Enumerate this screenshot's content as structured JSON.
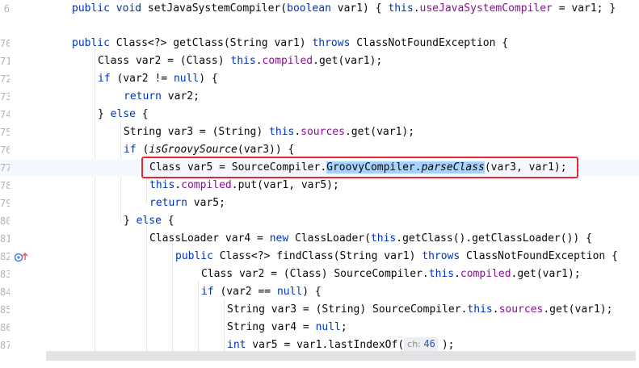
{
  "editor": {
    "line_numbers": [
      "6",
      "70",
      "71",
      "72",
      "73",
      "74",
      "75",
      "76",
      "77",
      "78",
      "79",
      "80",
      "81",
      "82",
      "83",
      "84",
      "85",
      "86",
      "87"
    ],
    "lines": [
      [
        {
          "t": "public void ",
          "c": "kw"
        },
        {
          "t": "setJavaSystemCompiler",
          "c": ""
        },
        {
          "t": "(",
          "c": ""
        },
        {
          "t": "boolean",
          "c": "kw"
        },
        {
          "t": " var1) { ",
          "c": ""
        },
        {
          "t": "this",
          "c": "kw"
        },
        {
          "t": ".",
          "c": ""
        },
        {
          "t": "useJavaSystemCompiler",
          "c": "fld"
        },
        {
          "t": " = var1; }",
          "c": ""
        }
      ],
      [
        {
          "t": "public ",
          "c": "kw"
        },
        {
          "t": "Class<?> getClass(String var1) ",
          "c": ""
        },
        {
          "t": "throws",
          "c": "kw"
        },
        {
          "t": " ClassNotFoundException {",
          "c": ""
        }
      ],
      [
        {
          "t": "Class var2 = (Class) ",
          "c": ""
        },
        {
          "t": "this",
          "c": "kw"
        },
        {
          "t": ".",
          "c": ""
        },
        {
          "t": "compiled",
          "c": "fld"
        },
        {
          "t": ".get(var1);",
          "c": ""
        }
      ],
      [
        {
          "t": "if",
          "c": "kw"
        },
        {
          "t": " (var2 != ",
          "c": ""
        },
        {
          "t": "null",
          "c": "kw"
        },
        {
          "t": ") {",
          "c": ""
        }
      ],
      [
        {
          "t": "return",
          "c": "kw"
        },
        {
          "t": " var2;",
          "c": ""
        }
      ],
      [
        {
          "t": "} ",
          "c": ""
        },
        {
          "t": "else",
          "c": "kw"
        },
        {
          "t": " {",
          "c": ""
        }
      ],
      [
        {
          "t": "String var3 = (String) ",
          "c": ""
        },
        {
          "t": "this",
          "c": "kw"
        },
        {
          "t": ".",
          "c": ""
        },
        {
          "t": "sources",
          "c": "fld"
        },
        {
          "t": ".get(var1);",
          "c": ""
        }
      ],
      [
        {
          "t": "if",
          "c": "kw"
        },
        {
          "t": " (",
          "c": ""
        },
        {
          "t": "isGroovySource",
          "c": "it"
        },
        {
          "t": "(var3)) {",
          "c": ""
        }
      ],
      [
        {
          "t": "Class var5 = SourceCompiler.",
          "c": ""
        },
        {
          "t": "GroovyCompiler.",
          "c": "sel"
        },
        {
          "t": "parseClass",
          "c": "it sel"
        },
        {
          "t": "(var3, var1);",
          "c": ""
        }
      ],
      [
        {
          "t": "this",
          "c": "kw"
        },
        {
          "t": ".",
          "c": ""
        },
        {
          "t": "compiled",
          "c": "fld"
        },
        {
          "t": ".put(var1, var5);",
          "c": ""
        }
      ],
      [
        {
          "t": "return",
          "c": "kw"
        },
        {
          "t": " var5;",
          "c": ""
        }
      ],
      [
        {
          "t": "} ",
          "c": ""
        },
        {
          "t": "else",
          "c": "kw"
        },
        {
          "t": " {",
          "c": ""
        }
      ],
      [
        {
          "t": "ClassLoader var4 = ",
          "c": ""
        },
        {
          "t": "new",
          "c": "kw"
        },
        {
          "t": " ClassLoader(",
          "c": ""
        },
        {
          "t": "this",
          "c": "kw"
        },
        {
          "t": ".getClass().getClassLoader()) {",
          "c": ""
        }
      ],
      [
        {
          "t": "public ",
          "c": "kw"
        },
        {
          "t": "Class<?> findClass(String var1) ",
          "c": ""
        },
        {
          "t": "throws",
          "c": "kw"
        },
        {
          "t": " ClassNotFoundException {",
          "c": ""
        }
      ],
      [
        {
          "t": "Class var2 = (Class) SourceCompiler.",
          "c": ""
        },
        {
          "t": "this",
          "c": "kw"
        },
        {
          "t": ".",
          "c": ""
        },
        {
          "t": "compiled",
          "c": "fld"
        },
        {
          "t": ".get(var1);",
          "c": ""
        }
      ],
      [
        {
          "t": "if",
          "c": "kw"
        },
        {
          "t": " (var2 == ",
          "c": ""
        },
        {
          "t": "null",
          "c": "kw"
        },
        {
          "t": ") {",
          "c": ""
        }
      ],
      [
        {
          "t": "String var3 = (String) SourceCompiler.",
          "c": ""
        },
        {
          "t": "this",
          "c": "kw"
        },
        {
          "t": ".",
          "c": ""
        },
        {
          "t": "sources",
          "c": "fld"
        },
        {
          "t": ".get(var1);",
          "c": ""
        }
      ],
      [
        {
          "t": "String var4 = ",
          "c": ""
        },
        {
          "t": "null",
          "c": "kw"
        },
        {
          "t": ";",
          "c": ""
        }
      ],
      [
        {
          "t": "int",
          "c": "kw"
        },
        {
          "t": " var5 = var1.lastIndexOf(",
          "c": ""
        },
        {
          "t": "HINT",
          "c": "hint"
        },
        {
          "t": ");",
          "c": ""
        }
      ]
    ],
    "inlay_hint": {
      "name": "ch:",
      "value": "46"
    },
    "current_line_number": "77",
    "gutter_icons": [
      "override-icon",
      "up-arrow-icon"
    ],
    "colors": {
      "keyword": "#0033b3",
      "field": "#871094",
      "selection": "#a6d2ff",
      "annotation_box": "#e8262c"
    }
  }
}
